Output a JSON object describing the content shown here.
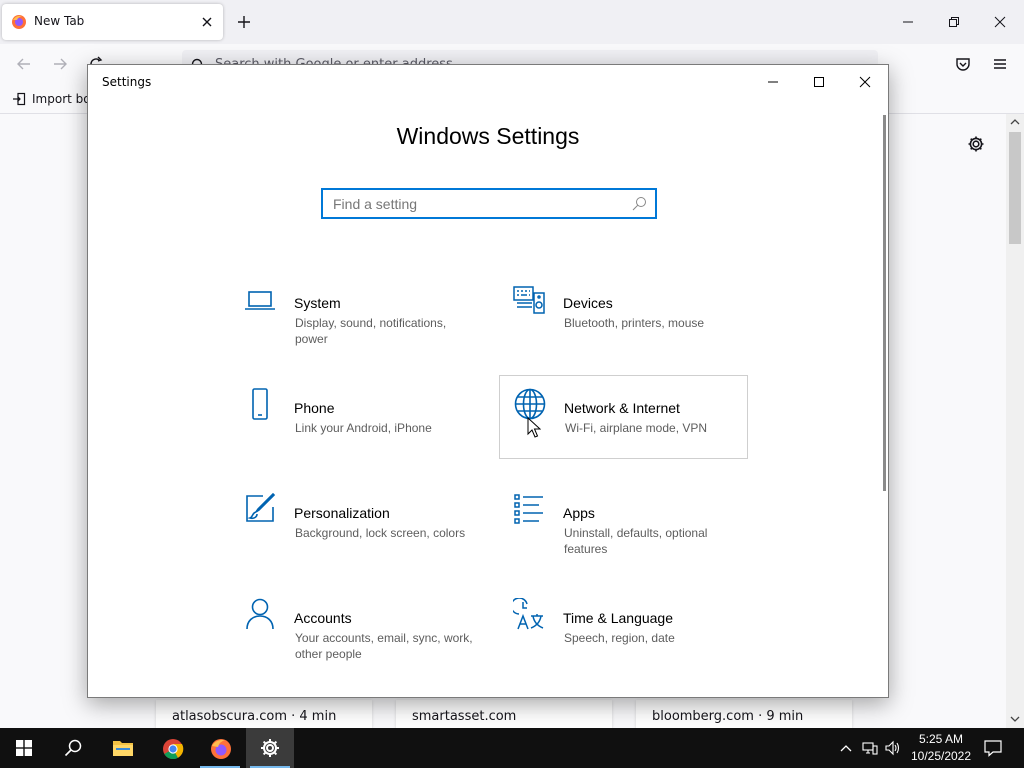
{
  "browser": {
    "tab": {
      "title": "New Tab"
    },
    "urlbar": {
      "placeholder": "Search with Google or enter address"
    },
    "bookmarks": {
      "import_label": "Import boo"
    },
    "top_sites": [
      {
        "label": "atlasobscura.com · 4 min"
      },
      {
        "label": "smartasset.com"
      },
      {
        "label": "bloomberg.com · 9 min"
      }
    ]
  },
  "settings_window": {
    "title": "Settings",
    "heading": "Windows Settings",
    "search": {
      "placeholder": "Find a setting"
    },
    "accent_color": "#0078d7",
    "categories": [
      {
        "name": "System",
        "desc": "Display, sound, notifications, power",
        "icon": "laptop-icon"
      },
      {
        "name": "Devices",
        "desc": "Bluetooth, printers, mouse",
        "icon": "keyboard-speaker-icon"
      },
      {
        "name": "Phone",
        "desc": "Link your Android, iPhone",
        "icon": "phone-icon"
      },
      {
        "name": "Network & Internet",
        "desc": "Wi-Fi, airplane mode, VPN",
        "icon": "globe-icon"
      },
      {
        "name": "Personalization",
        "desc": "Background, lock screen, colors",
        "icon": "paint-brush-icon"
      },
      {
        "name": "Apps",
        "desc": "Uninstall, defaults, optional features",
        "icon": "apps-list-icon"
      },
      {
        "name": "Accounts",
        "desc": "Your accounts, email, sync, work, other people",
        "icon": "person-icon"
      },
      {
        "name": "Time & Language",
        "desc": "Speech, region, date",
        "icon": "time-language-icon"
      }
    ]
  },
  "taskbar": {
    "clock_time": "5:25 AM",
    "clock_date": "10/25/2022"
  }
}
